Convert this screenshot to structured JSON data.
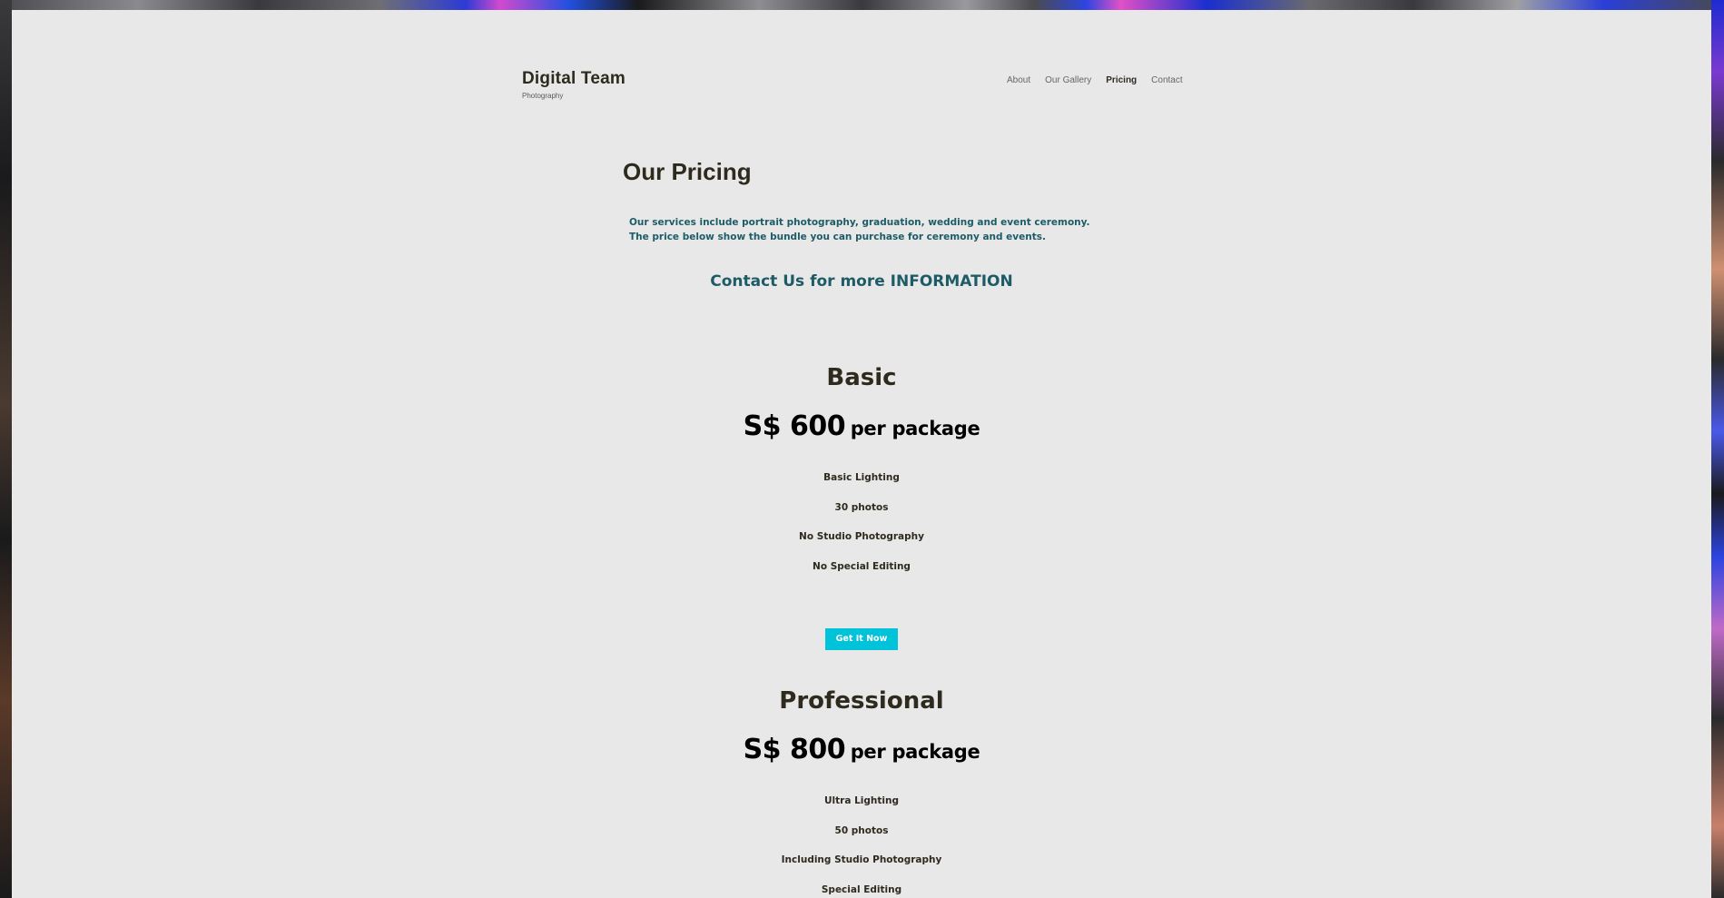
{
  "brand": {
    "title": "Digital Team",
    "subtitle": "Photography"
  },
  "nav": {
    "items": [
      {
        "label": "About",
        "active": false
      },
      {
        "label": "Our Gallery",
        "active": false
      },
      {
        "label": "Pricing",
        "active": true
      },
      {
        "label": "Contact",
        "active": false
      }
    ]
  },
  "page": {
    "title": "Our Pricing",
    "intro": "Our services include portrait photography, graduation, wedding and event ceremony. The price below show the bundle you can purchase for ceremony and events.",
    "contact_cta": "Contact Us for more INFORMATION"
  },
  "plans": [
    {
      "name": "Basic",
      "price": "S$ 600",
      "unit": "per package",
      "features": [
        "Basic Lighting",
        "30 photos",
        "No Studio Photography",
        "No Special Editing"
      ],
      "button": "Get It Now"
    },
    {
      "name": "Professional",
      "price": "S$ 800",
      "unit": "per package",
      "features": [
        "Ultra Lighting",
        "50 photos",
        "Including Studio Photography",
        "Special Editing"
      ]
    }
  ],
  "colors": {
    "accent": "#00c2d8",
    "teal_text": "#1d5c66",
    "heading": "#2e2a1e",
    "background": "#e8e8e8"
  }
}
